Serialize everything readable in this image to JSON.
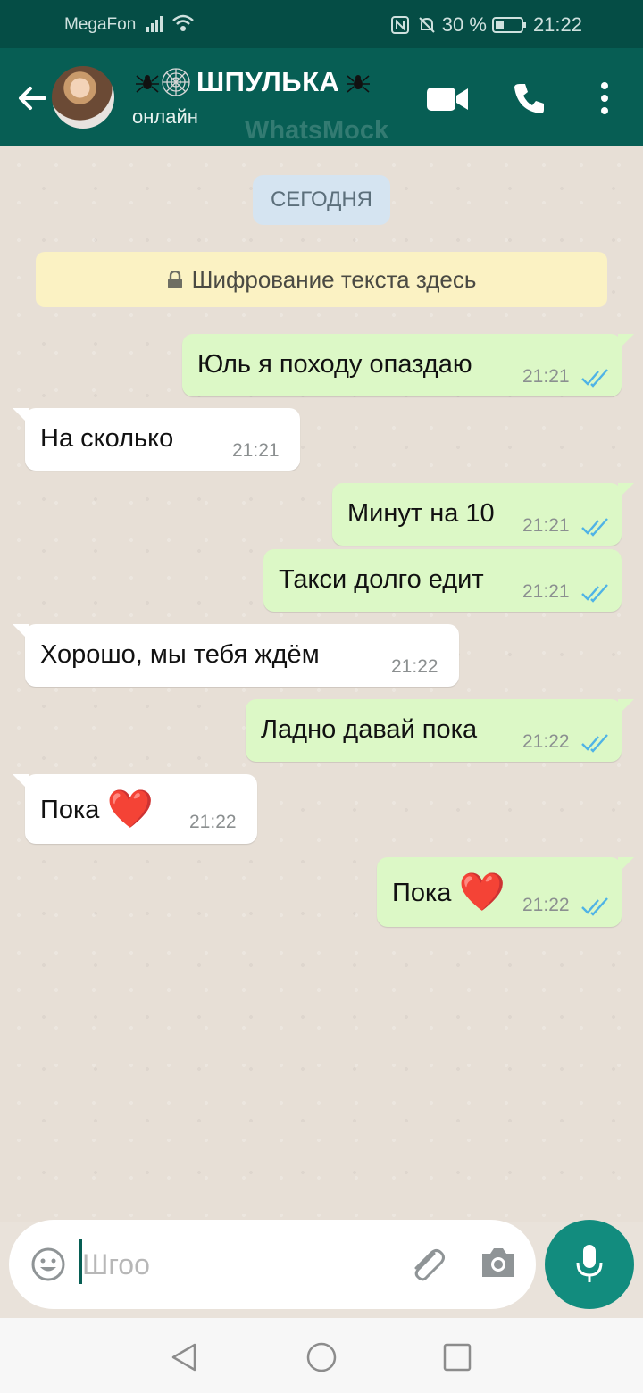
{
  "status_bar": {
    "carrier": "MegaFon",
    "battery_percent": "30 %",
    "time": "21:22"
  },
  "header": {
    "contact_name": "ШПУЛЬКА",
    "status": "онлайн",
    "watermark": "WhatsMock"
  },
  "chat": {
    "date_chip": "СЕГОДНЯ",
    "encryption_notice": "Шифрование текста здесь",
    "messages": [
      {
        "direction": "out",
        "text": "Юль я походу опаздаю",
        "time": "21:21",
        "read": true
      },
      {
        "direction": "in",
        "text": "На сколько",
        "time": "21:21"
      },
      {
        "direction": "out",
        "text": "Минут на 10",
        "time": "21:21",
        "read": true
      },
      {
        "direction": "out",
        "text": "Такси долго едит",
        "time": "21:21",
        "read": true
      },
      {
        "direction": "in",
        "text": "Хорошо, мы тебя ждём",
        "time": "21:22"
      },
      {
        "direction": "out",
        "text": "Ладно давай пока",
        "time": "21:22",
        "read": true
      },
      {
        "direction": "in",
        "text": "Пока",
        "emoji": "❤️",
        "time": "21:22"
      },
      {
        "direction": "out",
        "text": "Пока",
        "emoji": "❤️",
        "time": "21:22",
        "read": true
      }
    ]
  },
  "composer": {
    "input_value": "Шгоо"
  },
  "colors": {
    "header": "#075e54",
    "status_bar": "#054d45",
    "outgoing_bubble": "#dcf8c6",
    "incoming_bubble": "#ffffff",
    "read_ticks": "#4fb3e6",
    "mic_button": "#128c7e"
  },
  "icons": [
    "back-arrow-icon",
    "spider-icon",
    "spiderweb-icon",
    "video-call-icon",
    "phone-icon",
    "more-vert-icon",
    "lock-icon",
    "double-check-icon",
    "emoji-icon",
    "attach-icon",
    "camera-icon",
    "mic-icon",
    "nav-back-icon",
    "nav-home-icon",
    "nav-recent-icon"
  ]
}
